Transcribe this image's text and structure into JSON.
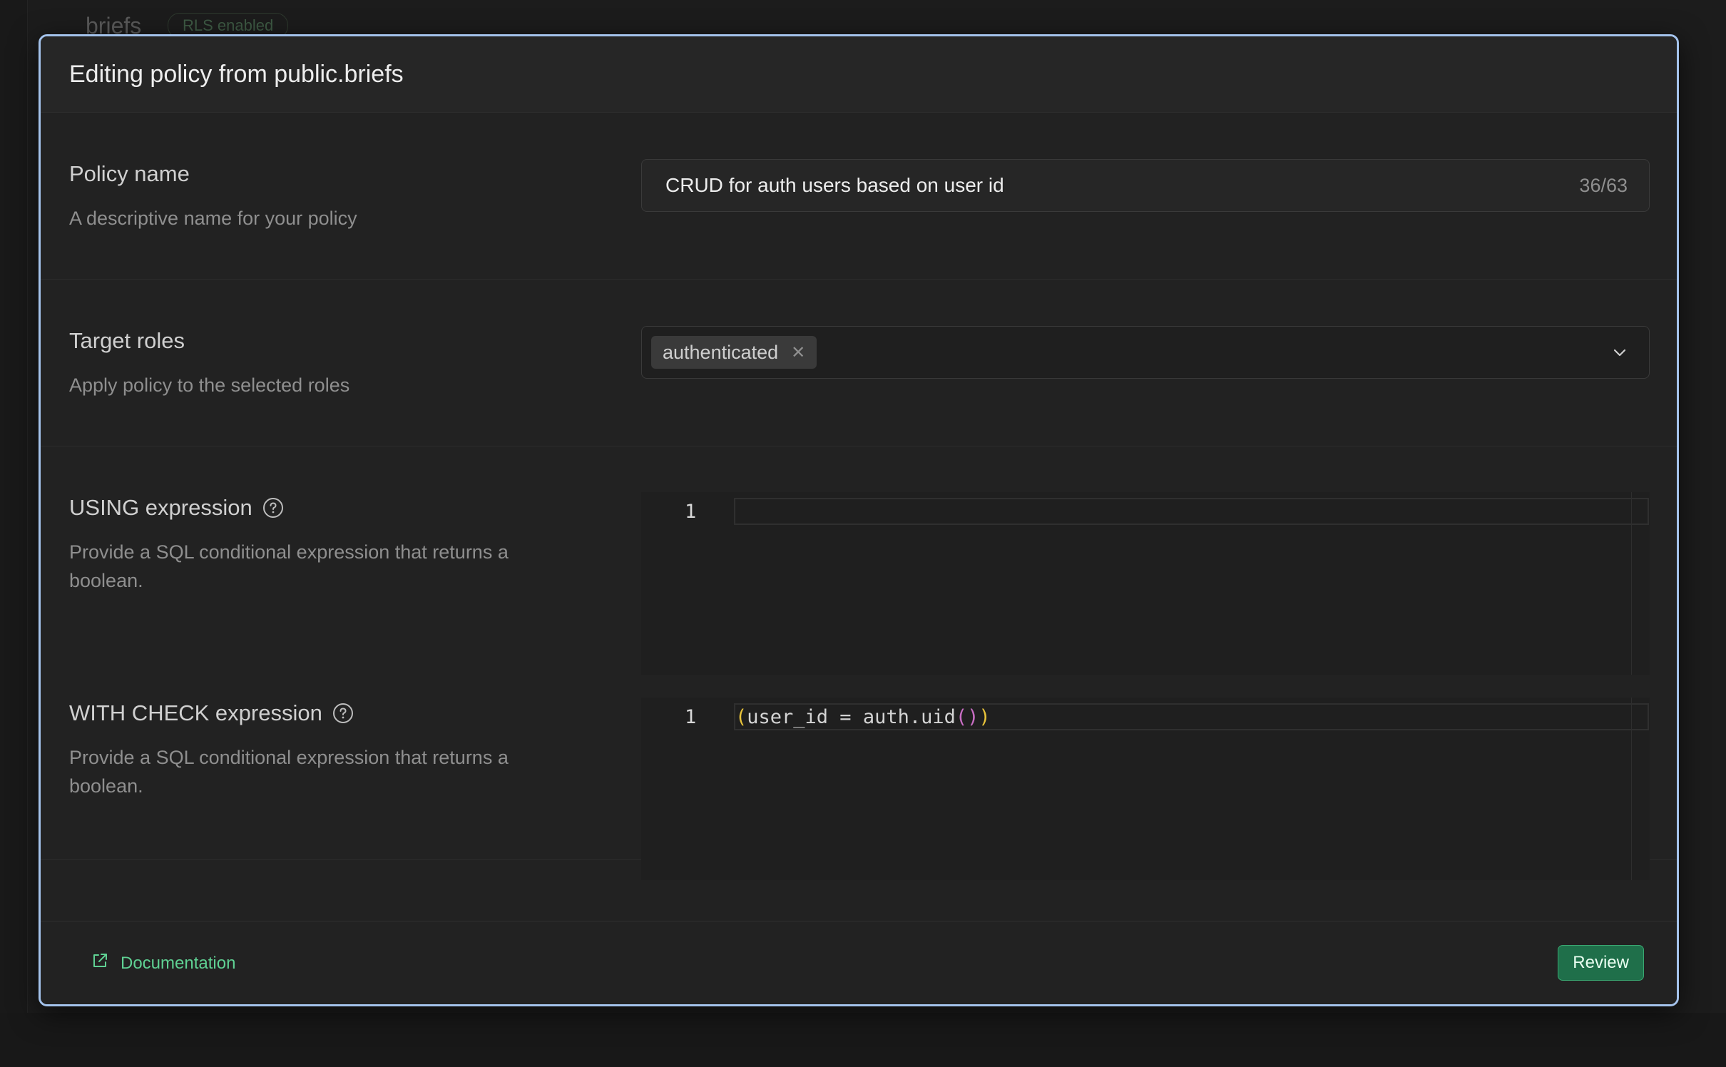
{
  "background": {
    "table_name": "briefs",
    "rls_badge": "RLS enabled"
  },
  "modal": {
    "title": "Editing policy from public.briefs"
  },
  "policy_name": {
    "label": "Policy name",
    "description": "A descriptive name for your policy",
    "value": "CRUD for auth users based on user id",
    "counter": "36/63"
  },
  "target_roles": {
    "label": "Target roles",
    "description": "Apply policy to the selected roles",
    "selected": [
      "authenticated"
    ]
  },
  "using_expression": {
    "label": "USING expression",
    "description": "Provide a SQL conditional expression that returns a boolean.",
    "line_number": "1",
    "code": ""
  },
  "with_check_expression": {
    "label": "WITH CHECK expression",
    "description": "Provide a SQL conditional expression that returns a boolean.",
    "line_number": "1",
    "code_open_paren": "(",
    "code_body": "user_id = auth.uid",
    "code_call_parens": "()",
    "code_close_paren": ")"
  },
  "footer": {
    "documentation_label": "Documentation",
    "review_label": "Review"
  },
  "colors": {
    "accent_green": "#3ecf8e",
    "modal_border": "#a4c3ec",
    "review_bg": "#1f6f4a"
  },
  "icons": {
    "help": "question-circle-icon",
    "external_link": "external-link-icon",
    "chevron": "chevron-down-icon",
    "remove": "x-icon"
  }
}
